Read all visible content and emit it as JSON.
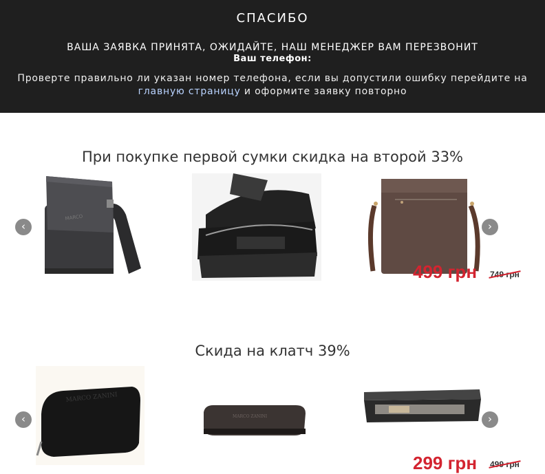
{
  "header": {
    "title": "СПАСИБО",
    "message": "ВАША ЗАЯВКА ПРИНЯТА, ОЖИДАЙТЕ, НАШ МЕНЕДЖЕР ВАМ ПЕРЕЗВОНИТ",
    "phone_label": "Ваш телефон:",
    "note_before": "Проверте правильно ли указан номер телефона, если вы допустили ошибку перейдите на",
    "note_link": "главную страницу",
    "note_after": "и оформите заявку повторно"
  },
  "sections": [
    {
      "title": "При покупке первой сумки скидка на второй 33%",
      "price_new": "499 грн",
      "price_old": "749 грн"
    },
    {
      "title": "Скида на клатч 39%",
      "price_new": "299 грн",
      "price_old": "499 грн"
    }
  ],
  "icons": {
    "prev": "chevron-left-icon",
    "next": "chevron-right-icon"
  },
  "colors": {
    "header_bg": "#1f1f1f",
    "link": "#b9d3ff",
    "price_red": "#d32430"
  }
}
